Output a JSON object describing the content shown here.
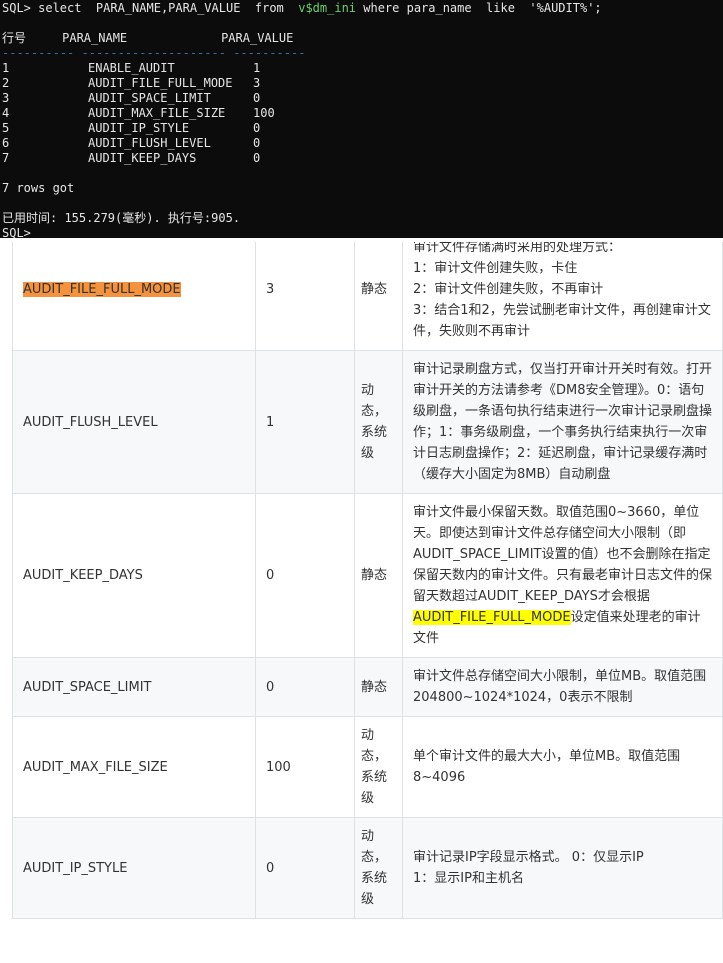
{
  "terminal": {
    "query_prompt": "SQL>",
    "query_pre": " select  PARA_NAME,PARA_VALUE  from  ",
    "query_table": "v$dm_ini",
    "query_post": " where para_name  like  '%AUDIT%';",
    "header_line": "行号     PARA_NAME             PARA_VALUE",
    "dash_line": "---------- -------------------- ----------",
    "rows": [
      {
        "num": "1",
        "name": "ENABLE_AUDIT",
        "value": "1"
      },
      {
        "num": "2",
        "name": "AUDIT_FILE_FULL_MODE",
        "value": "3"
      },
      {
        "num": "3",
        "name": "AUDIT_SPACE_LIMIT",
        "value": "0"
      },
      {
        "num": "4",
        "name": "AUDIT_MAX_FILE_SIZE",
        "value": "100"
      },
      {
        "num": "5",
        "name": "AUDIT_IP_STYLE",
        "value": "0"
      },
      {
        "num": "6",
        "name": "AUDIT_FLUSH_LEVEL",
        "value": "0"
      },
      {
        "num": "7",
        "name": "AUDIT_KEEP_DAYS",
        "value": "0"
      }
    ],
    "rows_got": "7 rows got",
    "elapsed": "已用时间: 155.279(毫秒). 执行号:905.",
    "final_prompt": "SQL>"
  },
  "doc_table": {
    "top_clipped_text": "审计文件存储满时采用的处理方式：",
    "rows": [
      {
        "name": "AUDIT_FILE_FULL_MODE",
        "value": "3",
        "attr": "静态",
        "desc_lines": [
          "1：审计文件创建失败，卡住",
          "2：审计文件创建失败，不再审计",
          "3：结合1和2，先尝试删老审计文件，再创建审计文件，失败则不再审计"
        ]
      },
      {
        "name": "AUDIT_FLUSH_LEVEL",
        "value": "1",
        "attr": "动态，系统级",
        "desc": "审计记录刷盘方式，仅当打开审计开关时有效。打开审计开关的方法请参考《DM8安全管理》。0：语句级刷盘，一条语句执行结束进行一次审计记录刷盘操作；1：事务级刷盘，一个事务执行结束执行一次审计日志刷盘操作；2：延迟刷盘，审计记录缓存满时（缓存大小固定为8MB）自动刷盘"
      },
      {
        "name": "AUDIT_KEEP_DAYS",
        "value": "0",
        "attr": "静态",
        "desc_pre": "审计文件最小保留天数。取值范围0~3660，单位天。即使达到审计文件总存储空间大小限制（即AUDIT_SPACE_LIMIT设置的值）也不会删除在指定保留天数内的审计文件。只有最老审计日志文件的保留天数超过AUDIT_KEEP_DAYS才会根据",
        "desc_hl": "AUDIT_FILE_FULL_MODE",
        "desc_post": "设定值来处理老的审计文件"
      },
      {
        "name": "AUDIT_SPACE_LIMIT",
        "value": "0",
        "attr": "静态",
        "desc": "审计文件总存储空间大小限制，单位MB。取值范围204800~1024*1024，0表示不限制"
      },
      {
        "name": "AUDIT_MAX_FILE_SIZE",
        "value": "100",
        "attr": "动态，系统级",
        "desc": "单个审计文件的最大大小，单位MB。取值范围8~4096"
      },
      {
        "name": "AUDIT_IP_STYLE",
        "value": "0",
        "attr": "动态，系统级",
        "desc_lines": [
          "审计记录IP字段显示格式。 0：仅显示IP",
          "1：显示IP和主机名"
        ]
      }
    ]
  },
  "colors": {
    "terminal_bg": "#0c0c0c",
    "highlight_orange": "#f5923e",
    "highlight_yellow": "#ffff00"
  }
}
